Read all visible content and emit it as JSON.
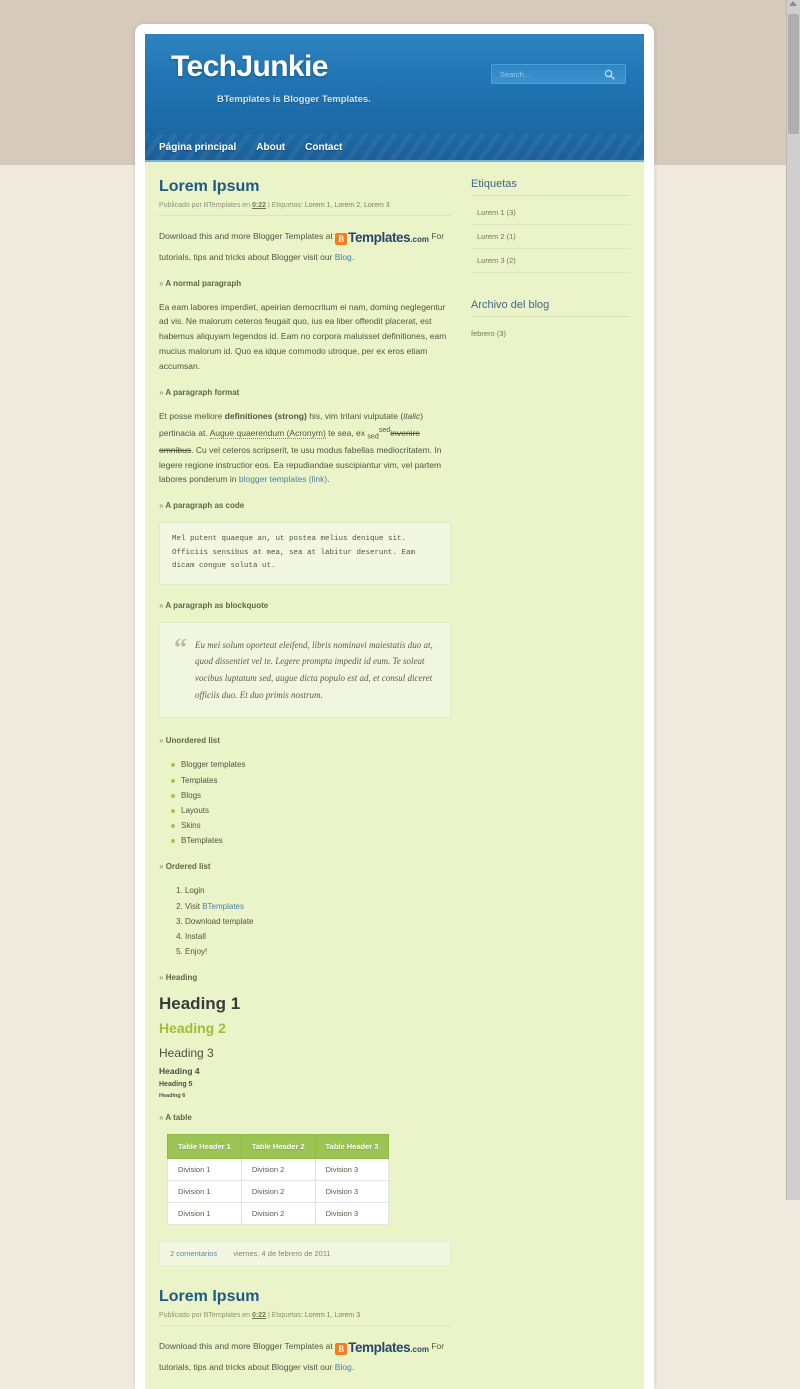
{
  "site": {
    "title": "TechJunkie",
    "description": "BTemplates is Blogger Templates."
  },
  "search": {
    "placeholder": "Search...",
    "value": "",
    "icon": "search-icon"
  },
  "nav": {
    "items": [
      {
        "label": "Página principal"
      },
      {
        "label": "About"
      },
      {
        "label": "Contact"
      }
    ]
  },
  "posts": [
    {
      "title": "Lorem Ipsum",
      "meta": {
        "published_by": "Publicado por BTemplates en",
        "time": "0:22",
        "separator": "| Etiquetas:",
        "tags": [
          "Lorem 1",
          "Lorem 2",
          "Lorem 3"
        ]
      },
      "intro": {
        "before": "Download this and more Blogger Templates at",
        "logo_b": "B",
        "logo_name": "Templates",
        "logo_com": ".com",
        "after": "For tutorials, tips and tricks about Blogger visit our",
        "link": "Blog",
        "period": "."
      },
      "sections": [
        {
          "heading": "A normal paragraph"
        },
        {
          "heading": "A paragraph format"
        },
        {
          "heading": "A paragraph as code"
        },
        {
          "heading": "A paragraph as blockquote"
        },
        {
          "heading": "Unordered list"
        },
        {
          "heading": "Ordered list"
        },
        {
          "heading": "Heading"
        },
        {
          "heading": "A table"
        }
      ],
      "normal_paragraph": "Ea eam labores imperdiet, apeirian democritum ei nam, doming neglegentur ad vis. Ne malorum ceteros feugait quo, ius ea liber offendit placerat, est habemus aliquyam legendos id. Eam no corpora maluisset definitiones, eam mucius malorum id. Quo ea idque commodo utroque, per ex eros etiam accumsan.",
      "format_paragraph": {
        "t1": "Et posse meliore ",
        "strong": "definitiones (strong)",
        "t2": " his, vim tritani vulputate (",
        "italic": "italic",
        "t3": ") pertinacia at. ",
        "acronym": "Augue quaerendum (Acronym)",
        "t4": " te sea, ex ",
        "sub": "sed",
        "sup": "sed",
        "strike": "invenire omnibus",
        "t5": ". Cu vel ceteros scripserit, te usu modus fabellas mediocritatem. In legere regione instructior eos. Ea repudiandae suscipiantur vim, vel partem labores ponderum in ",
        "link": "blogger templates (link)",
        "t6": "."
      },
      "code": "Mel putent quaeque an, ut postea melius denique sit. Officiis sensibus at mea, sea at labitur deserunt. Eam dicam congue soluta ut.",
      "blockquote": {
        "mark": "“",
        "text": "Eu mei solum oporteat eleifend, libris nominavi maiestatis duo at, quod dissentiet vel te. Legere prompta impedit id eum. Te soleat vocibus luptatum sed, augue dicta populo est ad, et consul diceret officiis duo. Et duo primis nostrum."
      },
      "unordered_list": [
        "Blogger templates",
        "Templates",
        "Blogs",
        "Layouts",
        "Skins",
        "BTemplates"
      ],
      "ordered_list": [
        {
          "text": "Login",
          "link": ""
        },
        {
          "text": "Visit ",
          "link": "BTemplates"
        },
        {
          "text": "Download template",
          "link": ""
        },
        {
          "text": "Install",
          "link": ""
        },
        {
          "text": "Enjoy!",
          "link": ""
        }
      ],
      "headings_demo": {
        "h1": "Heading 1",
        "h2": "Heading 2",
        "h3": "Heading 3",
        "h4": "Heading 4",
        "h5": "Heading 5",
        "h6": "Heading 6"
      },
      "table": {
        "headers": [
          "Table Header 1",
          "Table Header 2",
          "Table Header 3"
        ],
        "rows": [
          [
            "Division 1",
            "Division 2",
            "Division 3"
          ],
          [
            "Division 1",
            "Division 2",
            "Division 3"
          ],
          [
            "Division 1",
            "Division 2",
            "Division 3"
          ]
        ]
      },
      "footer": {
        "comments": "2 comentarios",
        "date": "viernes, 4 de febrero de 2011"
      }
    },
    {
      "title": "Lorem Ipsum",
      "meta": {
        "published_by": "Publicado por BTemplates en",
        "time": "0:22",
        "separator": "| Etiquetas:",
        "tags": [
          "Lorem 1",
          "Lorem 3"
        ]
      },
      "intro": {
        "before": "Download this and more Blogger Templates at",
        "logo_b": "B",
        "logo_name": "Templates",
        "logo_com": ".com",
        "after": "For tutorials, tips and tricks about Blogger visit our",
        "link": "Blog",
        "period": "."
      }
    }
  ],
  "sidebar": {
    "widgets": [
      {
        "title": "Etiquetas",
        "items": [
          {
            "label": "Lorem 1 (3)"
          },
          {
            "label": "Lorem 2 (1)"
          },
          {
            "label": "Lorem 3 (2)"
          }
        ]
      },
      {
        "title": "Archivo del blog",
        "items": [
          {
            "label": "febrero (3)"
          }
        ]
      }
    ]
  },
  "colors": {
    "header_blue": "#2276b4",
    "nav_blue": "#1d68a4",
    "content_bg": "#eaf4c8",
    "accent_green": "#9ac552",
    "link_blue": "#4a7fa8",
    "page_bg": "#f0e9de",
    "top_band": "#d5cabb",
    "logo_orange": "#f57d20"
  }
}
